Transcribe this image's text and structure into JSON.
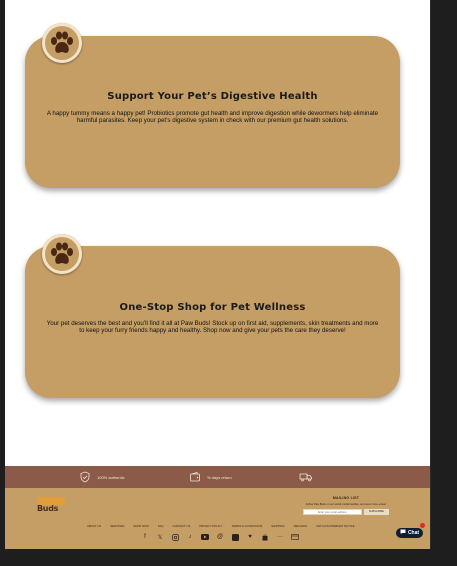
{
  "cards": [
    {
      "title": "Support Your Pet’s Digestive Health",
      "body": "A happy tummy means a happy pet! Probiotics promote gut health and improve digestion while dewormers help eliminate harmful parasites. Keep your pet’s digestive system in check with our premium gut health solutions."
    },
    {
      "title": "One-Stop Shop for Pet Wellness",
      "body": "Your pet deserves the best and you’ll find it all at Paw Buds! Stock up on first aid, supplements, skin treatments and more to keep your furry friends happy and healthy. Shop now and give your pets the care they deserve!"
    }
  ],
  "trust_bar": {
    "items": [
      {
        "icon": "shield-check-icon",
        "label": "100% authentic"
      },
      {
        "icon": "wallet-icon",
        "label": "% days return"
      },
      {
        "icon": "delivery-truck-icon",
        "label": ""
      }
    ]
  },
  "footer": {
    "logo_text": "Buds",
    "mailing_list": {
      "title": "MAILING LIST",
      "description": "Follow Paw Buds on our social media handles, and never miss a deal.",
      "input_placeholder": "Enter your email address",
      "button_label": "SUBSCRIBE"
    },
    "links": [
      "ABOUT US",
      "SERVICES",
      "SHOP NOW",
      "FAQ",
      "CONTACT US",
      "PRIVACY POLICY",
      "TERMS & CONDITIONS",
      "SHIPPING",
      "REFUNDS",
      "ANTI-COUNTERFEIT NOTICE"
    ],
    "social_icons": [
      "facebook-icon",
      "x-icon",
      "instagram-icon",
      "tiktok-icon",
      "youtube-icon",
      "threads-icon",
      "shop-app-icon",
      "heart-icon",
      "bag-icon",
      "more-icon",
      "card-icon"
    ]
  },
  "chat_widget": {
    "label": "Chat"
  },
  "colors": {
    "card_tan": "#c59e66",
    "trust_bar_brown": "#8c5a48",
    "footer_tan": "#c59e66",
    "chat_navy": "#0f1e33"
  }
}
